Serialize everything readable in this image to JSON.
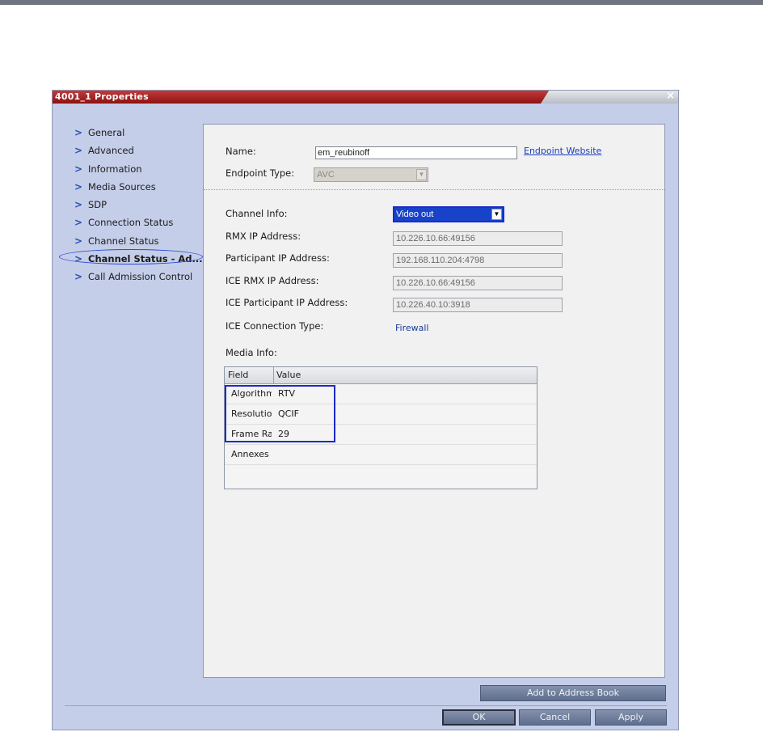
{
  "window": {
    "title": "4001_1 Properties",
    "close_glyph": "×"
  },
  "sidebar": {
    "chevron": ">",
    "items": [
      {
        "label": "General"
      },
      {
        "label": "Advanced"
      },
      {
        "label": "Information"
      },
      {
        "label": "Media Sources"
      },
      {
        "label": "SDP"
      },
      {
        "label": "Connection Status"
      },
      {
        "label": "Channel Status"
      },
      {
        "label": "Channel Status - Ad...",
        "active": true
      },
      {
        "label": "Call Admission Control"
      }
    ]
  },
  "form": {
    "name_label": "Name:",
    "name_value": "em_reubinoff",
    "endpoint_website_link": "Endpoint Website",
    "endpoint_type_label": "Endpoint Type:",
    "endpoint_type_value": "AVC",
    "channel_info_label": "Channel Info:",
    "channel_info_value": "Video out",
    "rmx_ip_label": "RMX IP Address:",
    "rmx_ip_value": "10.226.10.66:49156",
    "participant_ip_label": "Participant IP Address:",
    "participant_ip_value": "192.168.110.204:4798",
    "ice_rmx_ip_label": "ICE RMX IP Address:",
    "ice_rmx_ip_value": "10.226.10.66:49156",
    "ice_participant_ip_label": "ICE Participant IP Address:",
    "ice_participant_ip_value": "10.226.40.10:3918",
    "ice_connection_type_label": "ICE Connection Type:",
    "ice_connection_type_value": "Firewall",
    "media_info_label": "Media Info:"
  },
  "media_table": {
    "columns": [
      "Field",
      "Value"
    ],
    "rows": [
      {
        "field": "Algorithm",
        "value": "RTV"
      },
      {
        "field": "Resolution",
        "value": "QCIF"
      },
      {
        "field": "Frame Rate",
        "value": "29"
      },
      {
        "field": "Annexes",
        "value": ""
      }
    ]
  },
  "buttons": {
    "add_to_address_book": "Add to Address Book",
    "ok": "OK",
    "cancel": "Cancel",
    "apply": "Apply"
  },
  "icons": {
    "dropdown_arrow": "▼"
  },
  "colors": {
    "titlebar_red": "#a52020",
    "dialog_bg": "#c5cee9",
    "selection_blue": "#1742c9",
    "highlight_outline": "#1c2cc8",
    "button_bg": "#6f7e9c"
  }
}
